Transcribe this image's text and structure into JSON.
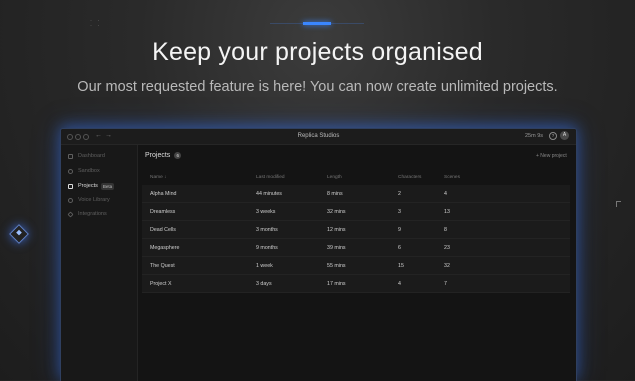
{
  "hero": {
    "headline": "Keep your projects organised",
    "subline": "Our most requested feature is here! You can now create unlimited projects."
  },
  "window": {
    "title": "Replica Studios",
    "credits": "25m 9s",
    "help": "?",
    "avatar": "A",
    "nav_back": "←",
    "nav_forward": "→"
  },
  "sidebar": {
    "items": [
      {
        "label": "Dashboard",
        "icon": "dashboard-icon"
      },
      {
        "label": "Sandbox",
        "icon": "sandbox-icon"
      },
      {
        "label": "Projects",
        "icon": "projects-icon",
        "badge": "Beta",
        "active": true
      },
      {
        "label": "Voice Library",
        "icon": "voice-library-icon"
      },
      {
        "label": "Integrations",
        "icon": "integrations-icon"
      }
    ]
  },
  "projects": {
    "title": "Projects",
    "count": "6",
    "new_project": "+ New project",
    "columns": [
      "Name ↓",
      "Last modified",
      "Length",
      "Characters",
      "Scenes"
    ],
    "rows": [
      [
        "Alpha Mind",
        "44 minutes",
        "8 mins",
        "2",
        "4"
      ],
      [
        "Dreamless",
        "3 weeks",
        "32 mins",
        "3",
        "13"
      ],
      [
        "Dead Cells",
        "3 months",
        "12 mins",
        "9",
        "8"
      ],
      [
        "Megasphere",
        "9 months",
        "39 mins",
        "6",
        "23"
      ],
      [
        "The Quest",
        "1 week",
        "55 mins",
        "15",
        "32"
      ],
      [
        "Project X",
        "3 days",
        "17 mins",
        "4",
        "7"
      ]
    ]
  },
  "colors": {
    "accent": "#3a86ff",
    "background": "#1d1d1d",
    "panel": "#151515"
  }
}
